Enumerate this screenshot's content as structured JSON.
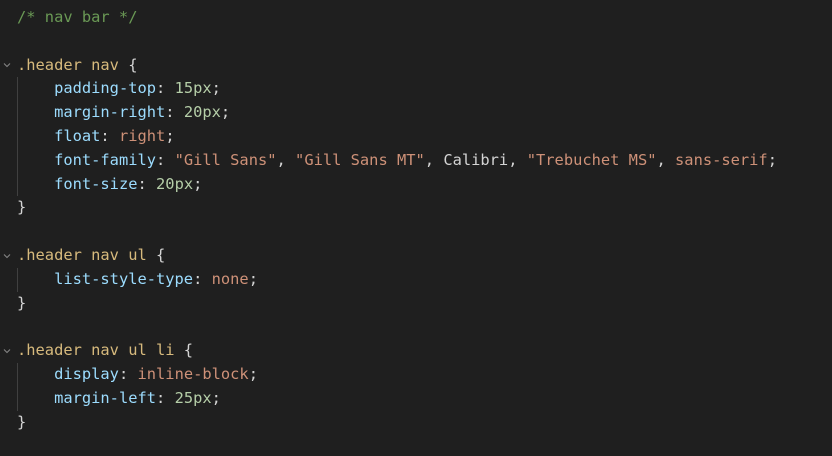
{
  "comment": "/* nav bar */",
  "rules": [
    {
      "selector": ".header nav",
      "declarations": [
        {
          "prop": "padding-top",
          "value": "15px",
          "kind": "num"
        },
        {
          "prop": "margin-right",
          "value": "20px",
          "kind": "num"
        },
        {
          "prop": "float",
          "value": "right",
          "kind": "val"
        },
        {
          "prop": "font-family",
          "kind": "fontlist",
          "parts": [
            "\"Gill Sans\"",
            "\"Gill Sans MT\"",
            "Calibri",
            "\"Trebuchet MS\"",
            "sans-serif"
          ]
        },
        {
          "prop": "font-size",
          "value": "20px",
          "kind": "num"
        }
      ]
    },
    {
      "selector": ".header nav ul",
      "declarations": [
        {
          "prop": "list-style-type",
          "value": "none",
          "kind": "val"
        }
      ]
    },
    {
      "selector": ".header nav ul li",
      "declarations": [
        {
          "prop": "display",
          "value": "inline-block",
          "kind": "val"
        },
        {
          "prop": "margin-left",
          "value": "25px",
          "kind": "num"
        }
      ]
    }
  ],
  "colors": {
    "background": "#1f1f1f",
    "comment": "#6a9955",
    "selector": "#d7ba7d",
    "property": "#9cdcfe",
    "number": "#b5cea8",
    "string": "#ce9178",
    "punctuation": "#d4d4d4"
  },
  "icons": {
    "fold": "chevron-down-icon"
  }
}
